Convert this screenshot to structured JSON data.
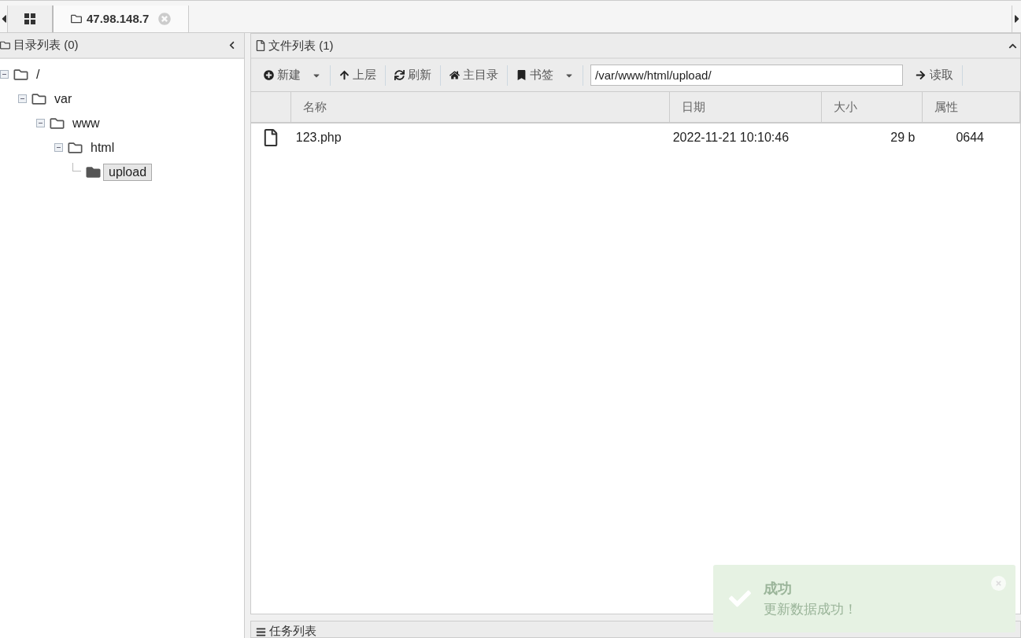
{
  "tabs": [
    {
      "label": "47.98.148.7",
      "selected": true
    }
  ],
  "dir_panel": {
    "title": "目录列表 (0)",
    "tree": [
      {
        "label": "/",
        "expanded": true,
        "selected": false,
        "children": [
          {
            "label": "var",
            "expanded": true,
            "selected": false,
            "children": [
              {
                "label": "www",
                "expanded": true,
                "selected": false,
                "children": [
                  {
                    "label": "html",
                    "expanded": true,
                    "selected": false,
                    "children": [
                      {
                        "label": "upload",
                        "selected": true
                      }
                    ]
                  }
                ]
              }
            ]
          }
        ]
      }
    ]
  },
  "file_panel": {
    "title": "文件列表 (1)",
    "toolbar": [
      {
        "kind": "dropdown",
        "label": "新建"
      },
      {
        "kind": "button",
        "label": "上层"
      },
      {
        "kind": "button",
        "label": "刷新"
      },
      {
        "kind": "button",
        "label": "主目录"
      },
      {
        "kind": "dropdown",
        "label": "书签"
      }
    ],
    "path": "/var/www/html/upload/",
    "read_button": "读取",
    "columns": [
      "名称",
      "日期",
      "大小",
      "属性"
    ],
    "rows": [
      {
        "name": "123.php",
        "date": "2022-11-21 10:10:46",
        "size": "29 b",
        "perms": "0644"
      }
    ]
  },
  "task_panel": {
    "title": "任务列表"
  },
  "toast": {
    "title": "成功",
    "message": "更新数据成功！"
  }
}
